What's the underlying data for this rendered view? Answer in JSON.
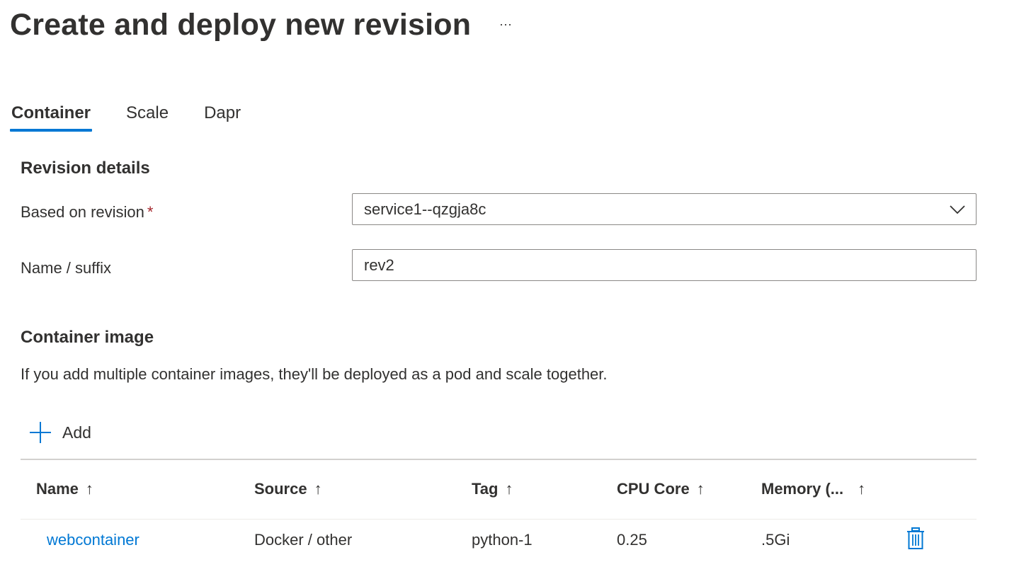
{
  "page": {
    "title": "Create and deploy new revision",
    "more_label": "···"
  },
  "tabs": [
    {
      "label": "Container",
      "active": true
    },
    {
      "label": "Scale",
      "active": false
    },
    {
      "label": "Dapr",
      "active": false
    }
  ],
  "revision_details": {
    "heading": "Revision details",
    "based_on_label": "Based on revision",
    "required_marker": "*",
    "based_on_value": "service1--qzgja8c",
    "name_label": "Name / suffix",
    "name_value": "rev2"
  },
  "container_image": {
    "heading": "Container image",
    "description": "If you add multiple container images, they'll be deployed as a pod and scale together.",
    "add_label": "Add"
  },
  "table": {
    "sort_arrow": "↑",
    "columns": [
      "Name",
      "Source",
      "Tag",
      "CPU Core",
      "Memory (..."
    ],
    "rows": [
      {
        "name": "webcontainer",
        "source": "Docker / other",
        "tag": "python-1",
        "cpu": "0.25",
        "memory": ".5Gi"
      }
    ]
  },
  "icons": {
    "more": "more-ellipsis-icon",
    "chevron": "chevron-down-icon",
    "add": "plus-icon",
    "delete": "trash-icon"
  },
  "colors": {
    "accent": "#0078d4",
    "text": "#323130",
    "required": "#a4262c",
    "border": "#8a8886"
  }
}
